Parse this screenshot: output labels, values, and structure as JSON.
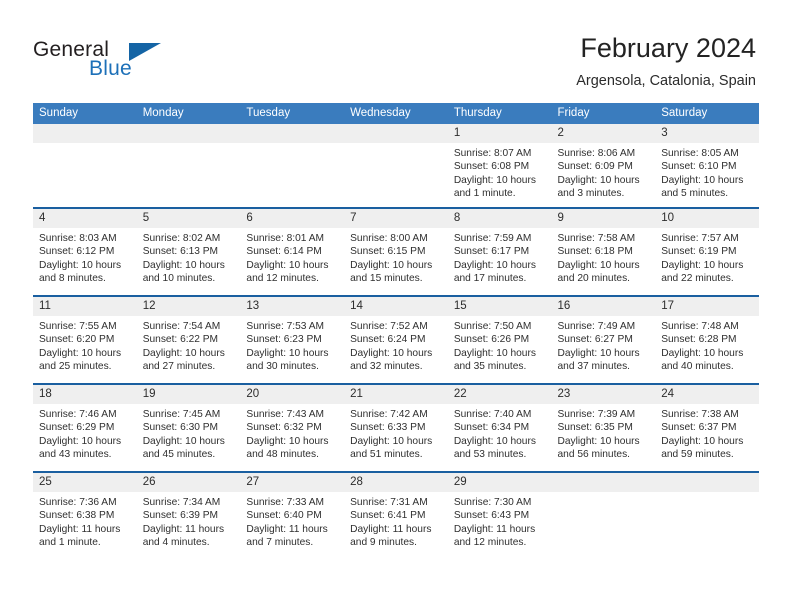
{
  "brand": {
    "name_part1": "General",
    "name_part2": "Blue",
    "mark": "triangle-logo"
  },
  "header": {
    "title": "February 2024",
    "location": "Argensola, Catalonia, Spain"
  },
  "calendar": {
    "weekdays": [
      "Sunday",
      "Monday",
      "Tuesday",
      "Wednesday",
      "Thursday",
      "Friday",
      "Saturday"
    ],
    "colors": {
      "header_bar": "#3a7cbe",
      "row_divider": "#1a5fa0",
      "day_number_band": "#efefef",
      "brand_blue": "#1d70b8"
    },
    "weeks": [
      [
        {
          "day": "",
          "lines": []
        },
        {
          "day": "",
          "lines": []
        },
        {
          "day": "",
          "lines": []
        },
        {
          "day": "",
          "lines": []
        },
        {
          "day": "1",
          "lines": [
            "Sunrise: 8:07 AM",
            "Sunset: 6:08 PM",
            "Daylight: 10 hours",
            "and 1 minute."
          ]
        },
        {
          "day": "2",
          "lines": [
            "Sunrise: 8:06 AM",
            "Sunset: 6:09 PM",
            "Daylight: 10 hours",
            "and 3 minutes."
          ]
        },
        {
          "day": "3",
          "lines": [
            "Sunrise: 8:05 AM",
            "Sunset: 6:10 PM",
            "Daylight: 10 hours",
            "and 5 minutes."
          ]
        }
      ],
      [
        {
          "day": "4",
          "lines": [
            "Sunrise: 8:03 AM",
            "Sunset: 6:12 PM",
            "Daylight: 10 hours",
            "and 8 minutes."
          ]
        },
        {
          "day": "5",
          "lines": [
            "Sunrise: 8:02 AM",
            "Sunset: 6:13 PM",
            "Daylight: 10 hours",
            "and 10 minutes."
          ]
        },
        {
          "day": "6",
          "lines": [
            "Sunrise: 8:01 AM",
            "Sunset: 6:14 PM",
            "Daylight: 10 hours",
            "and 12 minutes."
          ]
        },
        {
          "day": "7",
          "lines": [
            "Sunrise: 8:00 AM",
            "Sunset: 6:15 PM",
            "Daylight: 10 hours",
            "and 15 minutes."
          ]
        },
        {
          "day": "8",
          "lines": [
            "Sunrise: 7:59 AM",
            "Sunset: 6:17 PM",
            "Daylight: 10 hours",
            "and 17 minutes."
          ]
        },
        {
          "day": "9",
          "lines": [
            "Sunrise: 7:58 AM",
            "Sunset: 6:18 PM",
            "Daylight: 10 hours",
            "and 20 minutes."
          ]
        },
        {
          "day": "10",
          "lines": [
            "Sunrise: 7:57 AM",
            "Sunset: 6:19 PM",
            "Daylight: 10 hours",
            "and 22 minutes."
          ]
        }
      ],
      [
        {
          "day": "11",
          "lines": [
            "Sunrise: 7:55 AM",
            "Sunset: 6:20 PM",
            "Daylight: 10 hours",
            "and 25 minutes."
          ]
        },
        {
          "day": "12",
          "lines": [
            "Sunrise: 7:54 AM",
            "Sunset: 6:22 PM",
            "Daylight: 10 hours",
            "and 27 minutes."
          ]
        },
        {
          "day": "13",
          "lines": [
            "Sunrise: 7:53 AM",
            "Sunset: 6:23 PM",
            "Daylight: 10 hours",
            "and 30 minutes."
          ]
        },
        {
          "day": "14",
          "lines": [
            "Sunrise: 7:52 AM",
            "Sunset: 6:24 PM",
            "Daylight: 10 hours",
            "and 32 minutes."
          ]
        },
        {
          "day": "15",
          "lines": [
            "Sunrise: 7:50 AM",
            "Sunset: 6:26 PM",
            "Daylight: 10 hours",
            "and 35 minutes."
          ]
        },
        {
          "day": "16",
          "lines": [
            "Sunrise: 7:49 AM",
            "Sunset: 6:27 PM",
            "Daylight: 10 hours",
            "and 37 minutes."
          ]
        },
        {
          "day": "17",
          "lines": [
            "Sunrise: 7:48 AM",
            "Sunset: 6:28 PM",
            "Daylight: 10 hours",
            "and 40 minutes."
          ]
        }
      ],
      [
        {
          "day": "18",
          "lines": [
            "Sunrise: 7:46 AM",
            "Sunset: 6:29 PM",
            "Daylight: 10 hours",
            "and 43 minutes."
          ]
        },
        {
          "day": "19",
          "lines": [
            "Sunrise: 7:45 AM",
            "Sunset: 6:30 PM",
            "Daylight: 10 hours",
            "and 45 minutes."
          ]
        },
        {
          "day": "20",
          "lines": [
            "Sunrise: 7:43 AM",
            "Sunset: 6:32 PM",
            "Daylight: 10 hours",
            "and 48 minutes."
          ]
        },
        {
          "day": "21",
          "lines": [
            "Sunrise: 7:42 AM",
            "Sunset: 6:33 PM",
            "Daylight: 10 hours",
            "and 51 minutes."
          ]
        },
        {
          "day": "22",
          "lines": [
            "Sunrise: 7:40 AM",
            "Sunset: 6:34 PM",
            "Daylight: 10 hours",
            "and 53 minutes."
          ]
        },
        {
          "day": "23",
          "lines": [
            "Sunrise: 7:39 AM",
            "Sunset: 6:35 PM",
            "Daylight: 10 hours",
            "and 56 minutes."
          ]
        },
        {
          "day": "24",
          "lines": [
            "Sunrise: 7:38 AM",
            "Sunset: 6:37 PM",
            "Daylight: 10 hours",
            "and 59 minutes."
          ]
        }
      ],
      [
        {
          "day": "25",
          "lines": [
            "Sunrise: 7:36 AM",
            "Sunset: 6:38 PM",
            "Daylight: 11 hours",
            "and 1 minute."
          ]
        },
        {
          "day": "26",
          "lines": [
            "Sunrise: 7:34 AM",
            "Sunset: 6:39 PM",
            "Daylight: 11 hours",
            "and 4 minutes."
          ]
        },
        {
          "day": "27",
          "lines": [
            "Sunrise: 7:33 AM",
            "Sunset: 6:40 PM",
            "Daylight: 11 hours",
            "and 7 minutes."
          ]
        },
        {
          "day": "28",
          "lines": [
            "Sunrise: 7:31 AM",
            "Sunset: 6:41 PM",
            "Daylight: 11 hours",
            "and 9 minutes."
          ]
        },
        {
          "day": "29",
          "lines": [
            "Sunrise: 7:30 AM",
            "Sunset: 6:43 PM",
            "Daylight: 11 hours",
            "and 12 minutes."
          ]
        },
        {
          "day": "",
          "lines": []
        },
        {
          "day": "",
          "lines": []
        }
      ]
    ]
  }
}
